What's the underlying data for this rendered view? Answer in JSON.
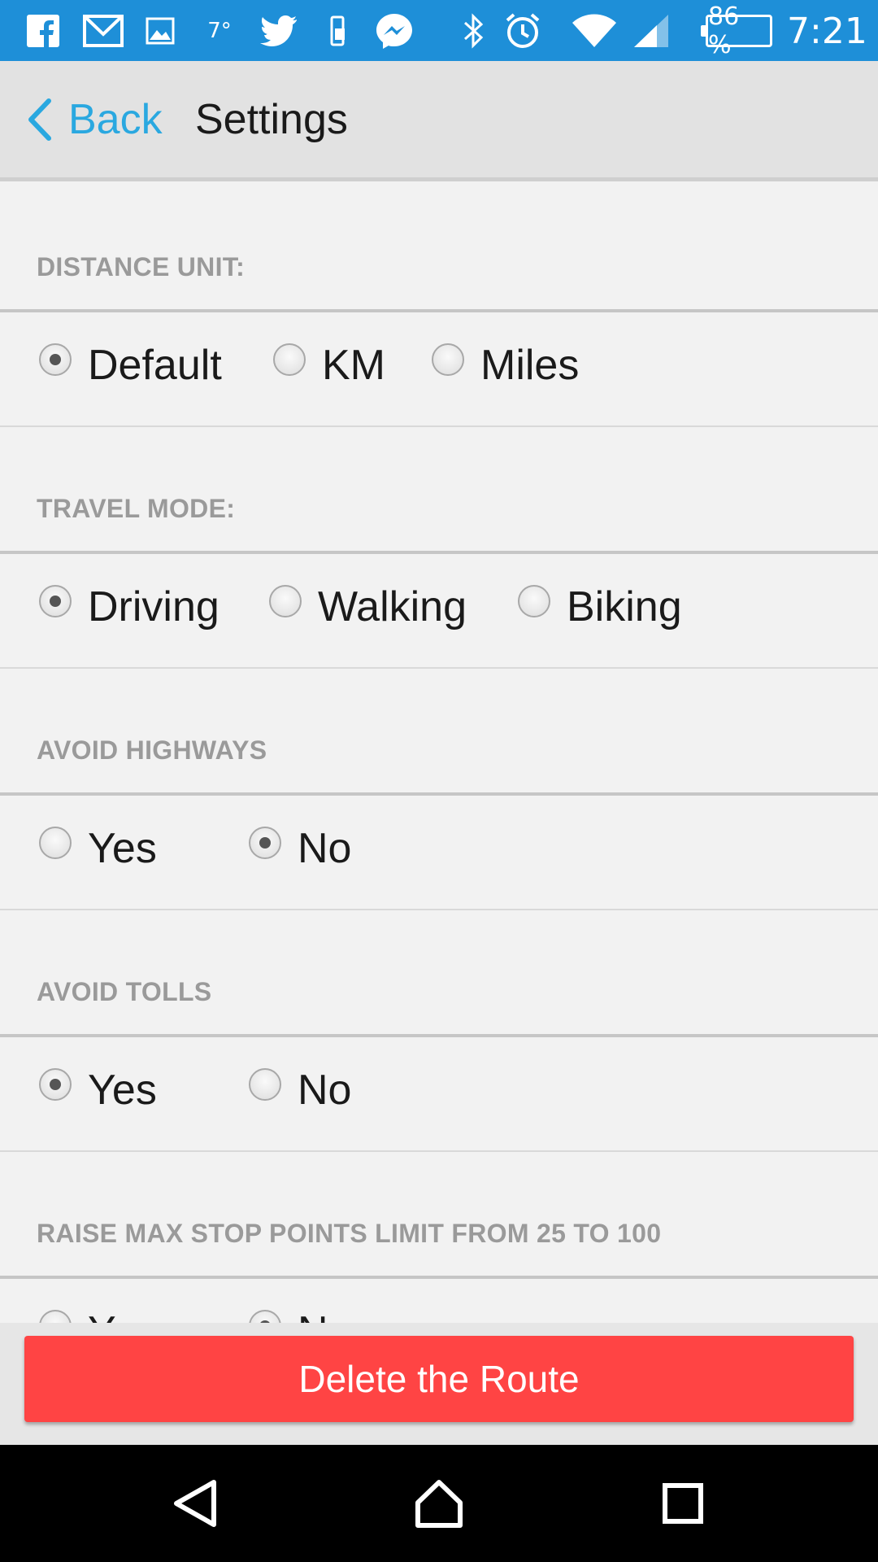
{
  "status_bar": {
    "temperature": "7°",
    "battery": "86 %",
    "time": "7:21",
    "icons": [
      "facebook-icon",
      "gmail-icon",
      "gallery-icon",
      "twitter-icon",
      "device-icon",
      "messenger-icon",
      "bluetooth-icon",
      "alarm-icon",
      "wifi-icon",
      "signal-icon"
    ]
  },
  "header": {
    "back_label": "Back",
    "title": "Settings",
    "accent_color": "#2aa8e0"
  },
  "sections": [
    {
      "heading": "DISTANCE UNIT:",
      "options": [
        "Default",
        "KM",
        "Miles"
      ],
      "selected": "Default"
    },
    {
      "heading": "TRAVEL MODE:",
      "options": [
        "Driving",
        "Walking",
        "Biking"
      ],
      "selected": "Driving"
    },
    {
      "heading": "AVOID HIGHWAYS",
      "options": [
        "Yes",
        "No"
      ],
      "selected": "No"
    },
    {
      "heading": "AVOID TOLLS",
      "options": [
        "Yes",
        "No"
      ],
      "selected": "Yes"
    },
    {
      "heading": "RAISE MAX STOP POINTS LIMIT FROM 25 TO 100",
      "options": [
        "Yes",
        "No"
      ],
      "selected": "No"
    }
  ],
  "footer": {
    "delete_label": "Delete the Route",
    "delete_color": "#ff4444"
  },
  "system_nav": [
    "back-nav-icon",
    "home-nav-icon",
    "recents-nav-icon"
  ]
}
